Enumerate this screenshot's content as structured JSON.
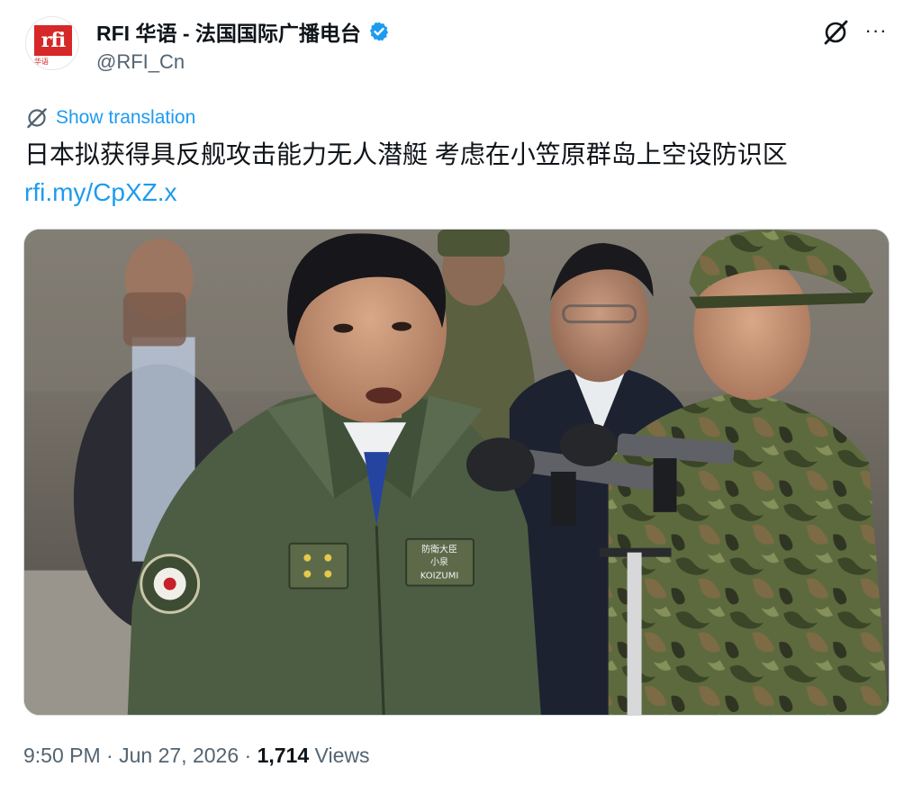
{
  "account": {
    "avatar_logo": "rfi",
    "avatar_sub": "华语",
    "display_name": "RFI 华语 - 法国国际广播电台",
    "handle": "@RFI_Cn",
    "verified": true
  },
  "actions": {
    "more_label": "···"
  },
  "translation": {
    "label": "Show translation"
  },
  "tweet": {
    "text": "日本拟获得具反舰攻击能力无人潜艇 考虑在小笠原群岛上空设防识区",
    "link": "rfi.my/CpXZ.x"
  },
  "meta": {
    "time": "9:50 PM",
    "sep1": " · ",
    "date": "Jun 27, 2026",
    "sep2": " · ",
    "views_count": "1,714",
    "views_label": " Views"
  },
  "colors": {
    "accent": "#1d9bf0",
    "secondary_text": "#536471",
    "brand_red": "#d62828"
  },
  "patch_text": {
    "title": "防衛大臣",
    "name_jp": "小泉",
    "name_en": "KOIZUMI"
  }
}
